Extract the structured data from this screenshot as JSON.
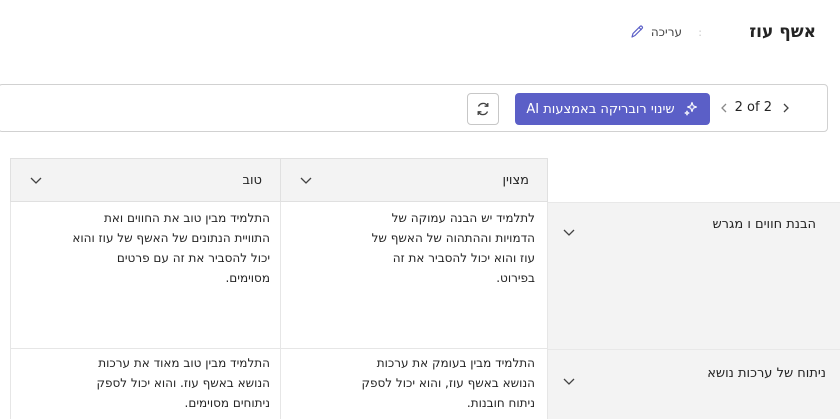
{
  "header": {
    "title": "אשף עוז",
    "edit_label": "עריכה",
    "separator": ":"
  },
  "toolbar": {
    "pagination": "2 of 2",
    "ai_button_label": "שינוי רובריקה באמצעות AI",
    "accent_color": "#5b5fc7",
    "icons": [
      "chevron-right-icon",
      "chevron-left-icon",
      "sparkle-icon",
      "refresh-icon"
    ]
  },
  "columns": [
    {
      "label": "מצוין"
    },
    {
      "label": "טוב"
    }
  ],
  "rows": [
    {
      "label": "הבנת חווים ו מגרש",
      "cells": [
        "לתלמיד יש הבנה עמוקה של הדמויות וההתהוה של האשף של עוז והוא יכול להסביר את זה בפירוט.",
        "התלמיד מבין טוב את החווים ואת התוויית הנתונים של האשף של עוז והוא יכול להסביר את זה עם פרטים מסוימים."
      ]
    },
    {
      "label": "ניתוח של ערכות נושא",
      "cells": [
        "התלמיד מבין בעומק את ערכות הנושא באשף עוז, והוא יכול לספק ניתוח חובנות.",
        "התלמיד מבין טוב מאוד את ערכות הנושא באשף עוז. והוא יכול לספק ניתוחים מסוימים."
      ]
    }
  ]
}
